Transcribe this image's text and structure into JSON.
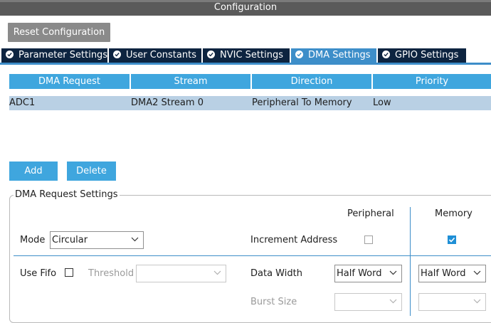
{
  "window": {
    "title": "Configuration"
  },
  "reset_button": {
    "label": "Reset Configuration"
  },
  "tabs": [
    {
      "label": "Parameter Settings",
      "active": false
    },
    {
      "label": "User Constants",
      "active": false
    },
    {
      "label": "NVIC Settings",
      "active": false
    },
    {
      "label": "DMA Settings",
      "active": true
    },
    {
      "label": "GPIO Settings",
      "active": false
    }
  ],
  "dma_table": {
    "columns": [
      "DMA Request",
      "Stream",
      "Direction",
      "Priority"
    ],
    "rows": [
      {
        "request": "ADC1",
        "stream": "DMA2 Stream 0",
        "direction": "Peripheral To Memory",
        "priority": "Low"
      }
    ]
  },
  "buttons": {
    "add": "Add",
    "delete": "Delete"
  },
  "settings": {
    "group_title": "DMA Request Settings",
    "peripheral_header": "Peripheral",
    "memory_header": "Memory",
    "mode_label": "Mode",
    "mode_value": "Circular",
    "increment_label": "Increment Address",
    "peripheral_increment": false,
    "memory_increment": true,
    "use_fifo_label": "Use Fifo",
    "use_fifo": false,
    "threshold_label": "Threshold",
    "threshold_value": "",
    "data_width_label": "Data Width",
    "peripheral_data_width": "Half Word",
    "memory_data_width": "Half Word",
    "burst_size_label": "Burst Size",
    "peripheral_burst": "",
    "memory_burst": ""
  },
  "colors": {
    "tab_active": "#3d8ec9",
    "tab_inactive": "#0d2440",
    "table_header": "#3fa6de",
    "row_selected": "#b9d0e4",
    "checkbox_checked": "#1f8fd6"
  }
}
